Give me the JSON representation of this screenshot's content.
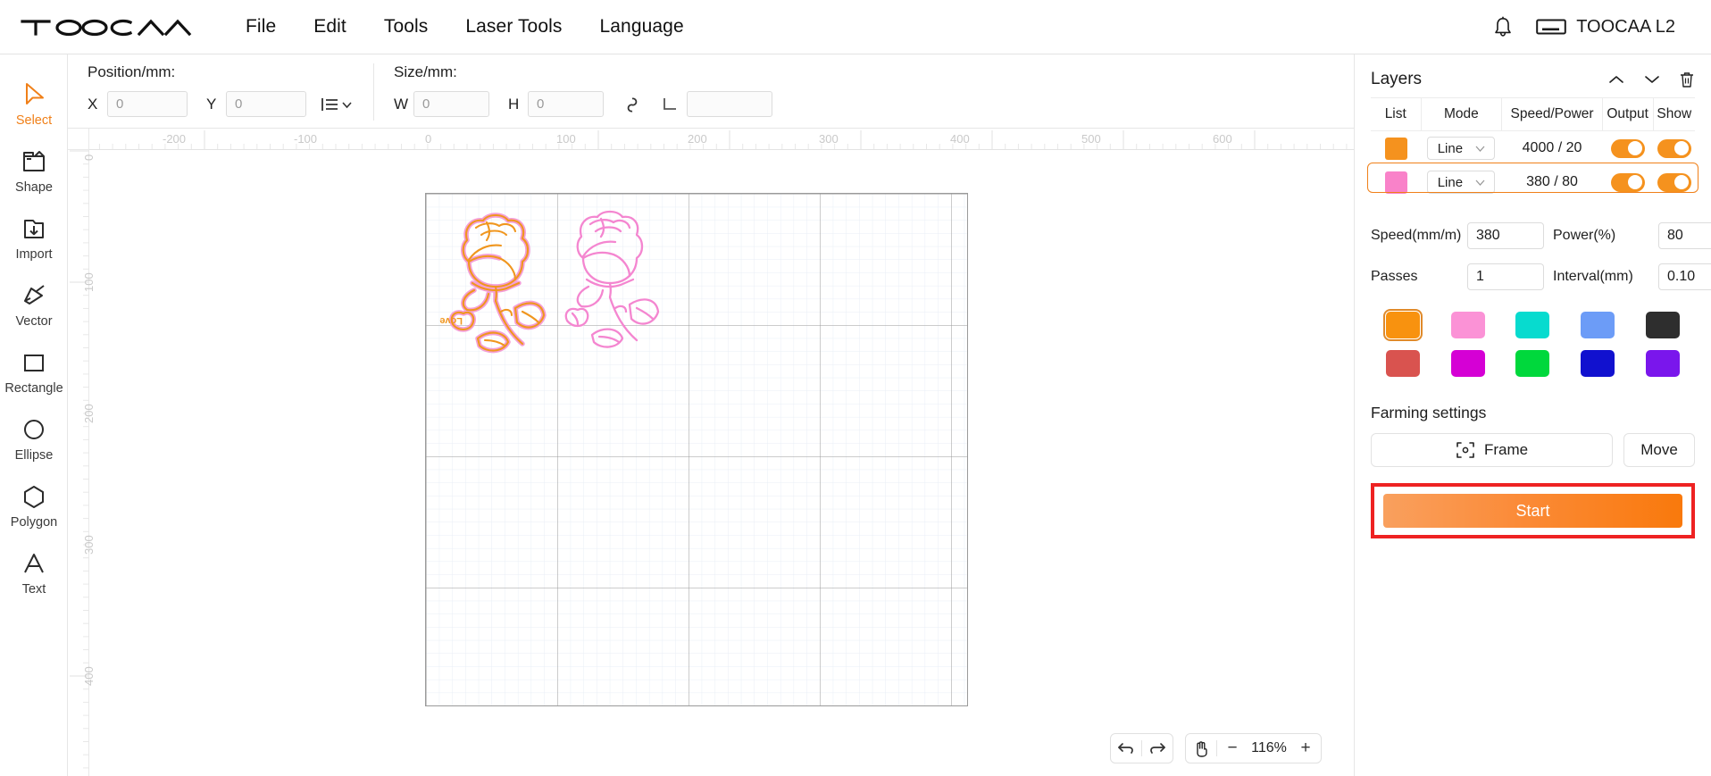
{
  "app": {
    "logo_text": "TOOCAA",
    "device_label": "TOOCAA L2"
  },
  "menubar": {
    "items": [
      {
        "label": "File"
      },
      {
        "label": "Edit"
      },
      {
        "label": "Tools"
      },
      {
        "label": "Laser Tools"
      },
      {
        "label": "Language"
      }
    ]
  },
  "sidebar": {
    "items": [
      {
        "label": "Select",
        "icon": "cursor-arrow-icon",
        "active": true
      },
      {
        "label": "Shape",
        "icon": "shape-folder-icon",
        "active": false
      },
      {
        "label": "Import",
        "icon": "import-icon",
        "active": false
      },
      {
        "label": "Vector",
        "icon": "vector-pen-icon",
        "active": false
      },
      {
        "label": "Rectangle",
        "icon": "rectangle-icon",
        "active": false
      },
      {
        "label": "Ellipse",
        "icon": "ellipse-icon",
        "active": false
      },
      {
        "label": "Polygon",
        "icon": "polygon-icon",
        "active": false
      },
      {
        "label": "Text",
        "icon": "text-icon",
        "active": false
      }
    ]
  },
  "optionbar": {
    "position_title": "Position/mm:",
    "x_label": "X",
    "x_value": "0",
    "y_label": "Y",
    "y_value": "0",
    "align_icon": "align-list-dropdown-icon",
    "size_title": "Size/mm:",
    "w_label": "W",
    "w_value": "0",
    "h_label": "H",
    "h_value": "0",
    "lock_icon": "link-chain-icon",
    "corner_icon": "corner-radius-icon",
    "corner_value": ""
  },
  "canvas": {
    "ruler_h_labels": [
      "0",
      "-200",
      "-100",
      "0",
      "100",
      "200",
      "300",
      "400",
      "500",
      "600"
    ],
    "ruler_v_labels": [
      "0",
      "100",
      "200",
      "300",
      "400"
    ],
    "artwork": [
      {
        "name": "rose-orange",
        "stroke": "#f0961e",
        "outline": "#f49ad4",
        "heart_text": "Love"
      },
      {
        "name": "rose-pink",
        "stroke": "#f486d0",
        "outline": "#f486d0",
        "heart_text": ""
      }
    ],
    "grid_minor_color": "#e8eef6",
    "grid_major_color": "#8f8f8f"
  },
  "zoom_bar": {
    "undo_icon": "undo-icon",
    "redo_icon": "redo-icon",
    "pan_icon": "hand-pan-icon",
    "minus_label": "−",
    "level": "116%",
    "plus_label": "+"
  },
  "layers_panel": {
    "title": "Layers",
    "move_up_icon": "chevron-up-icon",
    "move_down_icon": "chevron-down-icon",
    "delete_icon": "trash-icon",
    "columns": [
      "List",
      "Mode",
      "Speed/Power",
      "Output",
      "Show"
    ],
    "rows": [
      {
        "color": "#f5921e",
        "mode": "Line",
        "speed_power": "4000 / 20",
        "output": true,
        "show": true,
        "selected": false
      },
      {
        "color": "#f982c9",
        "mode": "Line",
        "speed_power": "380 / 80",
        "output": true,
        "show": true,
        "selected": true
      }
    ]
  },
  "settings": {
    "speed_label": "Speed(mm/m)",
    "speed_value": "380",
    "power_label": "Power(%)",
    "power_value": "80",
    "passes_label": "Passes",
    "passes_value": "1",
    "interval_label": "Interval(mm)",
    "interval_value": "0.10"
  },
  "palette": {
    "colors": [
      {
        "hex": "#f8920f",
        "selected": true
      },
      {
        "hex": "#fb92d6",
        "selected": false
      },
      {
        "hex": "#07dbcf",
        "selected": false
      },
      {
        "hex": "#6c9cf7",
        "selected": false
      },
      {
        "hex": "#2e2e2e",
        "selected": false
      },
      {
        "hex": "#d9534f",
        "selected": false
      },
      {
        "hex": "#d500d5",
        "selected": false
      },
      {
        "hex": "#00d83c",
        "selected": false
      },
      {
        "hex": "#1111cf",
        "selected": false
      },
      {
        "hex": "#7a16ec",
        "selected": false
      }
    ]
  },
  "farming": {
    "title": "Farming settings",
    "frame_label": "Frame",
    "frame_icon": "frame-target-icon",
    "move_label": "Move",
    "start_label": "Start",
    "highlight_color": "#ee2222"
  }
}
